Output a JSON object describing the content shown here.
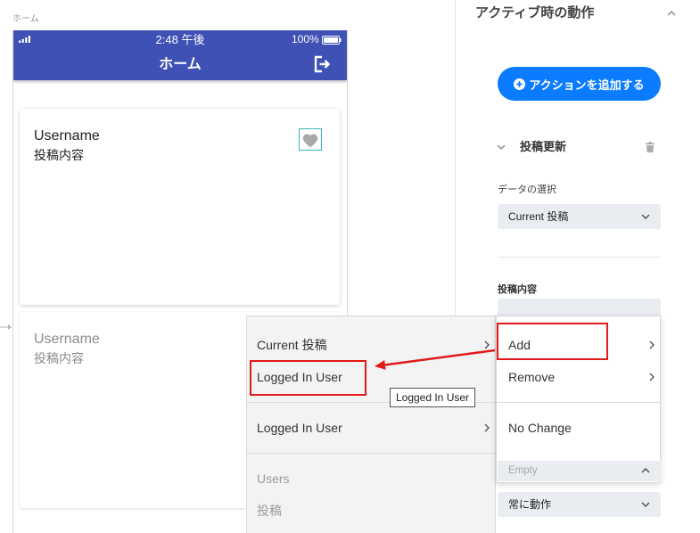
{
  "canvas": {
    "page_label": "ホーム",
    "connector_icon": "arrow-right-icon",
    "phone": {
      "status_bar": {
        "signal_icon": "signal-bars-icon",
        "time": "2:48 午後",
        "battery_text": "100%",
        "battery_icon": "battery-icon"
      },
      "header": {
        "title": "ホーム",
        "logout_icon": "logout-icon"
      },
      "cards": [
        {
          "username": "Username",
          "content": "投稿内容",
          "like_icon": "heart-icon"
        },
        {
          "username": "Username",
          "content": "投稿内容"
        }
      ]
    }
  },
  "panel": {
    "section_title": "アクティブ時の動作",
    "collapse_icon": "chevron-up-icon",
    "add_action": {
      "icon": "plus-circle-icon",
      "label": "アクションを追加する"
    },
    "action": {
      "expand_icon": "chevron-down-icon",
      "title": "投稿更新",
      "delete_icon": "trash-icon"
    },
    "data_select": {
      "label": "データの選択",
      "value": "Current 投稿"
    },
    "content_field": {
      "label": "投稿内容"
    },
    "list_value_select": {
      "value": "Empty"
    },
    "run_condition": {
      "value": "常に動作"
    }
  },
  "source_menu": {
    "items": [
      {
        "label": "Current 投稿",
        "has_submenu": true
      },
      {
        "label": "Logged In User",
        "has_submenu": false
      },
      {
        "label": "Logged In User",
        "has_submenu": true
      },
      {
        "label": "Users",
        "disabled": true
      },
      {
        "label": "投稿",
        "disabled": true
      }
    ]
  },
  "operation_menu": {
    "items": [
      {
        "label": "Add",
        "has_submenu": true
      },
      {
        "label": "Remove",
        "has_submenu": true
      },
      {
        "label": "No Change",
        "has_submenu": false
      }
    ]
  },
  "tooltip": {
    "text": "Logged In User"
  },
  "colors": {
    "app_bar": "#3f51b5",
    "primary_button": "#0b7cff",
    "annotation": "#e3191b",
    "selection_outline": "#39b3c0"
  }
}
